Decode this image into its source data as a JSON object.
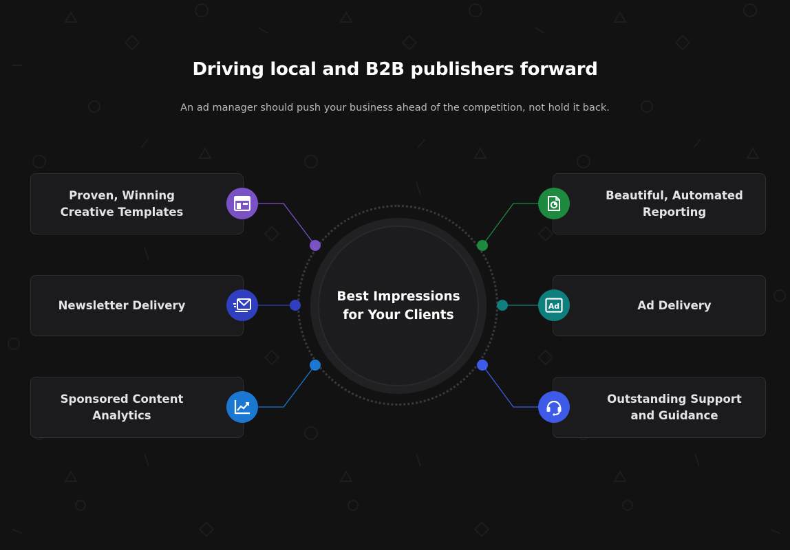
{
  "header": {
    "title": "Driving local and B2B publishers forward",
    "subtitle": "An ad manager should push your business ahead of the competition, not hold it back."
  },
  "hub": {
    "label": "Best Impressions for Your Clients"
  },
  "features": [
    {
      "label": "Proven, Winning Creative Templates",
      "icon": "template-layout-icon",
      "color": "#7b52c6"
    },
    {
      "label": "Newsletter Delivery",
      "icon": "email-send-icon",
      "color": "#2f3fc0"
    },
    {
      "label": "Sponsored Content Analytics",
      "icon": "line-chart-icon",
      "color": "#1a78d2"
    },
    {
      "label": "Beautiful, Automated Reporting",
      "icon": "report-document-icon",
      "color": "#1e8a3f"
    },
    {
      "label": "Ad Delivery",
      "icon": "ad-badge-icon",
      "color": "#0f7f7e"
    },
    {
      "label": "Outstanding Support and Guidance",
      "icon": "headset-support-icon",
      "color": "#3d5be6"
    }
  ],
  "colors": {
    "background": "#121213",
    "card": "#1b1b1d",
    "card_border": "#2f2f33",
    "hub": "#212123"
  }
}
